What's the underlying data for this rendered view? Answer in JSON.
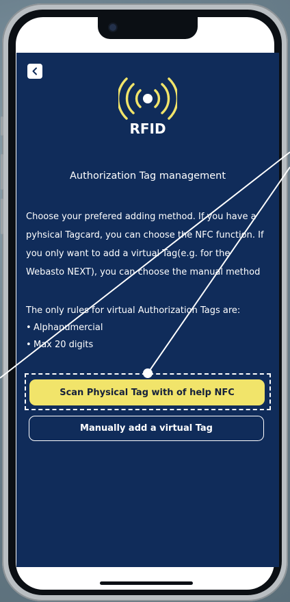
{
  "app": {
    "title": "RFID",
    "heading": "Authorization Tag management",
    "description": "Choose your prefered adding method. If you have a pyhsical Tagcard, you can choose the NFC function. If you only want to add a virtual Tag(e.g. for the Webasto NEXT), you can choose the manual method",
    "rules_intro": "The only rules for virtual Authorization Tags are:",
    "rules": [
      "Alphanumercial",
      "Max 20 digits"
    ],
    "bullet": "•",
    "buttons": {
      "nfc": "Scan Physical Tag with of help NFC",
      "manual": "Manually add a virtual Tag"
    },
    "icons": {
      "back": "chevron-left-icon",
      "rfid": "rfid-signal-icon"
    },
    "colors": {
      "background": "#102c5a",
      "accent": "#f1e46a",
      "icon": "#f1e46a",
      "text": "#ffffff"
    }
  }
}
